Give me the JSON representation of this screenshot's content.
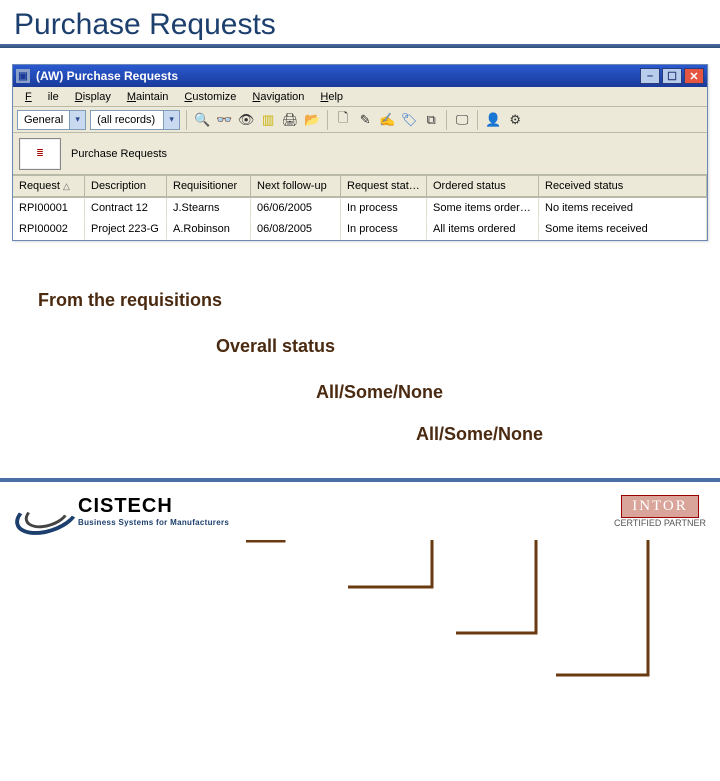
{
  "slide": {
    "title": "Purchase Requests"
  },
  "window": {
    "title": "(AW) Purchase Requests"
  },
  "menu": {
    "items": [
      "File",
      "Display",
      "Maintain",
      "Customize",
      "Navigation",
      "Help"
    ]
  },
  "toolbar": {
    "combo1": "General",
    "combo2": "(all records)"
  },
  "tab": {
    "label": "Purchase Requests"
  },
  "grid": {
    "columns": [
      "Request",
      "Description",
      "Requisitioner",
      "Next follow-up",
      "Request status",
      "Ordered status",
      "Received status"
    ],
    "rows": [
      {
        "c": [
          "RPI00001",
          "Contract 12",
          "J.Stearns",
          "06/06/2005",
          "In process",
          "Some items ordered",
          "No items received"
        ]
      },
      {
        "c": [
          "RPI00002",
          "Project 223-G",
          "A.Robinson",
          "06/08/2005",
          "In process",
          "All items ordered",
          "Some items received"
        ]
      }
    ]
  },
  "annotations": {
    "a1": "From the requisitions",
    "a2": "Overall status",
    "a3": "All/Some/None",
    "a4": "All/Some/None"
  },
  "footer": {
    "brand": "CISTECH",
    "tagline": "Business Systems for Manufacturers",
    "partner_brand": "INTOR",
    "partner_line": "CERTIFIED PARTNER"
  }
}
